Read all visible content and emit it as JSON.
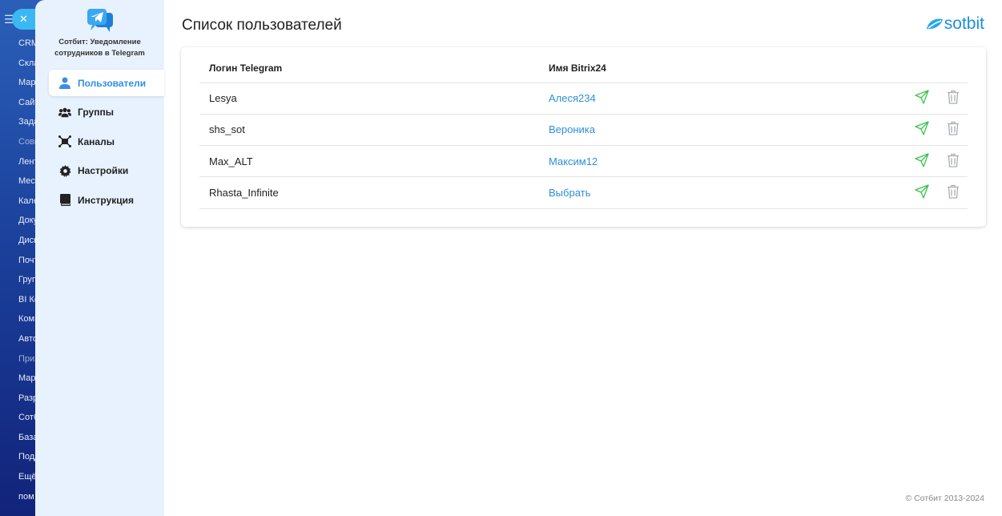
{
  "bitrix_menu": {
    "close": "✕",
    "items": [
      "CRM",
      "Скла",
      "Мар",
      "Сайт",
      "Зада",
      "Совм",
      "Лент",
      "Месс",
      "Кале",
      "Доку",
      "Диск",
      "Почт",
      "Груп",
      "BI Ко",
      "Комп",
      "Авто",
      "Прил",
      "Мар",
      "Разр",
      "Сотб",
      "База",
      "Подд",
      "Ещё",
      "пом"
    ]
  },
  "app": {
    "title": "Сотбит: Уведомление сотрудников в Telegram"
  },
  "nav": [
    {
      "label": "Пользователи",
      "icon": "user-icon"
    },
    {
      "label": "Группы",
      "icon": "users-icon"
    },
    {
      "label": "Каналы",
      "icon": "channel-icon"
    },
    {
      "label": "Настройки",
      "icon": "gear-icon"
    },
    {
      "label": "Инструкция",
      "icon": "book-icon"
    }
  ],
  "page": {
    "title": "Список пользователей",
    "brand": "sotbit",
    "footer": "© Сотбит 2013-2024"
  },
  "table": {
    "headers": [
      "Логин Telegram",
      "Имя Bitrix24"
    ],
    "rows": [
      {
        "login": "Lesya",
        "name": "Алеся234"
      },
      {
        "login": "shs_sot",
        "name": "Вероника"
      },
      {
        "login": "Max_ALT",
        "name": "Максим12"
      },
      {
        "login": "Rhasta_Infinite",
        "name": "Выбрать"
      }
    ]
  },
  "colors": {
    "accent": "#2f8fe6",
    "send": "#3cc44a",
    "trash": "#a9adb4"
  }
}
